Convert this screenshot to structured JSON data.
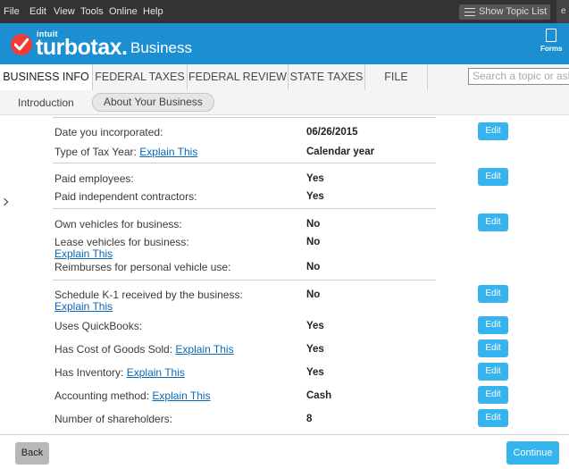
{
  "menubar": {
    "items": [
      "File",
      "Edit",
      "View",
      "Tools",
      "Online",
      "Help"
    ],
    "show_topic_list": "Show Topic List"
  },
  "brand": {
    "intuit": "intuit",
    "turbotax": "turbotax",
    "dot": ".",
    "business": "Business",
    "forms": "Forms",
    "accent": "#1c8fd3",
    "logo_color": "#ef3b39"
  },
  "tabs": [
    {
      "label": "BUSINESS INFO",
      "active": true
    },
    {
      "label": "FEDERAL TAXES",
      "active": false
    },
    {
      "label": "FEDERAL REVIEW",
      "active": false
    },
    {
      "label": "STATE TAXES",
      "active": false
    },
    {
      "label": "FILE",
      "active": false
    }
  ],
  "search": {
    "placeholder": "Search a topic or ask a"
  },
  "subnav": {
    "intro": "Introduction",
    "current": "About Your Business"
  },
  "explain": "Explain This",
  "rows": {
    "date_incorporated": {
      "label": "Date you incorporated:",
      "value": "06/26/2015"
    },
    "tax_year": {
      "label": "Type of Tax Year:",
      "value": "Calendar year"
    },
    "paid_employees": {
      "label": "Paid employees:",
      "value": "Yes"
    },
    "paid_contractors": {
      "label": "Paid independent contractors:",
      "value": "Yes"
    },
    "own_vehicles": {
      "label": "Own vehicles for business:",
      "value": "No"
    },
    "lease_vehicles": {
      "label": "Lease vehicles for business:",
      "value": "No"
    },
    "reimburses": {
      "label": "Reimburses for personal vehicle use:",
      "value": "No"
    },
    "k1_received": {
      "label": "Schedule K-1 received by the business:",
      "value": "No"
    },
    "quickbooks": {
      "label": "Uses QuickBooks:",
      "value": "Yes"
    },
    "cogs": {
      "label": "Has Cost of Goods Sold:",
      "value": "Yes"
    },
    "inventory": {
      "label": "Has Inventory:",
      "value": "Yes"
    },
    "accounting": {
      "label": "Accounting method:",
      "value": "Cash"
    },
    "shareholders": {
      "label": "Number of shareholders:",
      "value": "8"
    }
  },
  "buttons": {
    "edit": "Edit",
    "back": "Back",
    "continue": "Continue"
  }
}
